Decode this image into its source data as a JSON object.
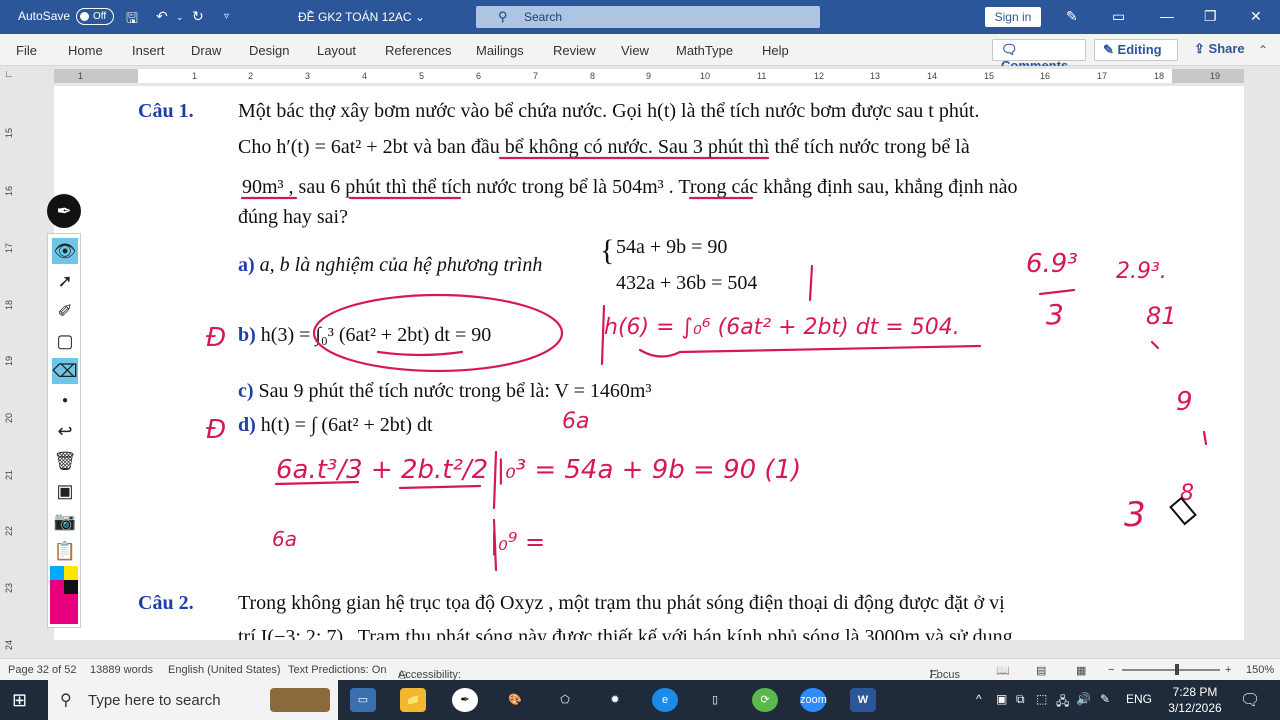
{
  "titlebar": {
    "autosave": "AutoSave",
    "autosave_state": "Off",
    "doc_title": "ĐỀ GK2 TOÁN 12AC ⌄",
    "search_placeholder": "Search",
    "signin": "Sign in"
  },
  "menu": {
    "tabs": [
      "File",
      "Home",
      "Insert",
      "Draw",
      "Design",
      "Layout",
      "References",
      "Mailings",
      "Review",
      "View",
      "MathType",
      "Help"
    ],
    "comments": "Comments",
    "editing": "Editing",
    "share": "Share"
  },
  "ruler": {
    "h_numbers": [
      "1",
      "1",
      "2",
      "3",
      "4",
      "5",
      "6",
      "7",
      "8",
      "9",
      "10",
      "11",
      "12",
      "13",
      "14",
      "15",
      "16",
      "17",
      "18",
      "19"
    ],
    "v_numbers": [
      "15",
      "16",
      "17",
      "18",
      "19",
      "20",
      "21",
      "22",
      "23",
      "24"
    ]
  },
  "document": {
    "q1_label": "Câu 1.",
    "q1_line1": "Một bác thợ xây bơm nước vào bể chứa nước. Gọi  h(t)  là thể tích nước bơm được sau  t  phút.",
    "q1_line2": "Cho  h′(t) = 6at² + 2bt  và ban đầu bể không có nước. Sau 3 phút thì thể tích nước trong bể là",
    "q1_line3": "90m³ , sau  6 phút thì thể tích nước trong bể là  504m³ . Trong các khẳng định sau, khẳng định nào",
    "q1_line4": "đúng hay sai?",
    "opt_a_label": "a)",
    "opt_a_text": "a, b là nghiệm của hệ phương trình",
    "opt_a_eq1": "54a + 9b = 90",
    "opt_a_eq2": "432a + 36b = 504",
    "opt_b_label": "b)",
    "opt_b_text": "h(3) = ∫₀³ (6at² + 2bt) dt = 90",
    "opt_c_label": "c)",
    "opt_c_text": "Sau 9 phút thể tích nước trong bể là: V = 1460m³",
    "opt_d_label": "d)",
    "opt_d_text": "h(t) = ∫ (6at² + 2bt) dt",
    "q2_label": "Câu 2.",
    "q2_line1": "Trong không gian hệ trục tọa độ  Oxyz , một trạm thu phát sóng điện thoại di động được đặt ở vị",
    "q2_line2": "trí  I(−3; 2; 7) . Trạm thu phát sóng này được thiết kế với bán kính phủ sóng là 3000m và sử dụng"
  },
  "ink": {
    "color": "#d6185a",
    "side_1": "6.9³",
    "side_2": "3",
    "side_3": "2.9³.",
    "side_4": "81",
    "b_note": "h(6) = ∫₀⁶ (6at² + 2bt) dt = 504.",
    "d_note_1": "6a",
    "d_note_2": "6a.t³/3 + 2b.t²/2 |₀³ = 54a + 9b = 90 (1)",
    "d_note_3": "|₀⁹ =",
    "d_note_4": "6a",
    "side_5": "9",
    "side_6": "3",
    "side_7": "8",
    "mark_b": "Đ",
    "mark_d": "Đ"
  },
  "statusbar": {
    "page": "Page 32 of 52",
    "words": "13889 words",
    "language": "English (United States)",
    "predictions": "Text Predictions: On",
    "accessibility": "Accessibility: Investigate",
    "focus": "Focus",
    "zoom": "150%"
  },
  "taskbar": {
    "search": "Type here to search",
    "lang": "ENG",
    "time": "7:28 PM",
    "date": "3/12/2026",
    "zoom_app": "zoom",
    "word_app": "W"
  }
}
